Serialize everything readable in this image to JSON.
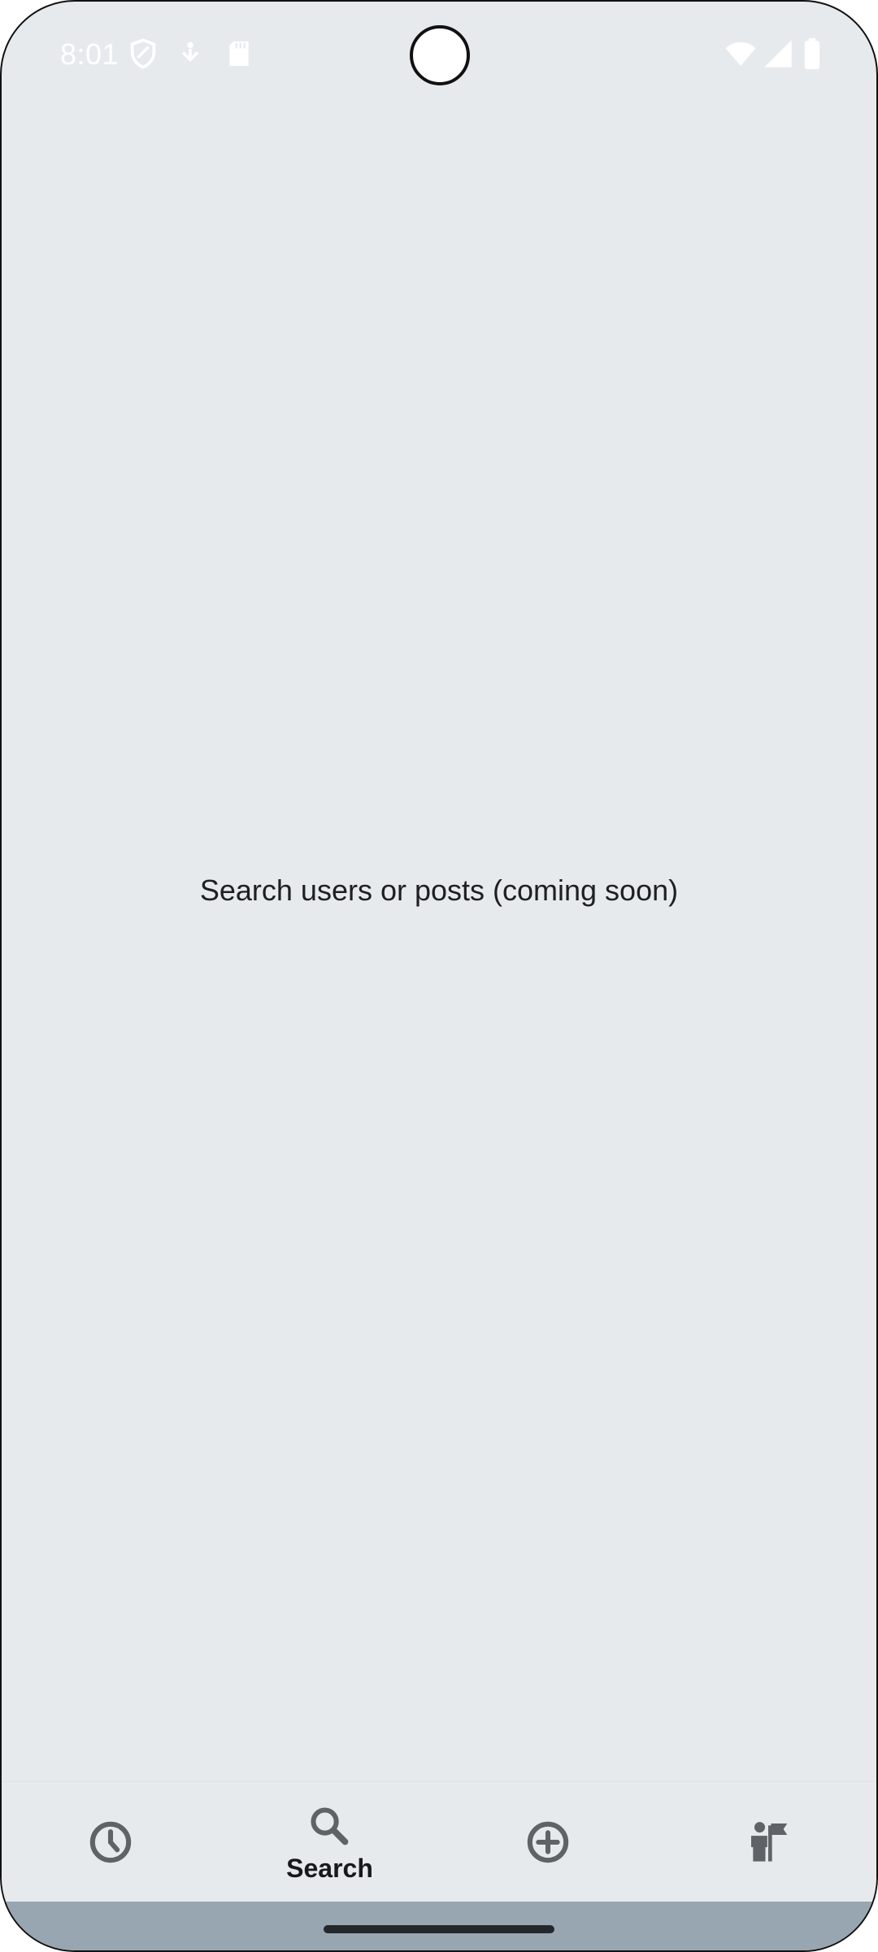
{
  "status_bar": {
    "time": "8:01",
    "left_icons": [
      "shield-icon",
      "download-icon",
      "sd-card-icon"
    ],
    "right_icons": [
      "wifi-icon",
      "signal-icon",
      "battery-icon"
    ],
    "icon_color": "#ffffff"
  },
  "main": {
    "message": "Search users or posts (coming soon)",
    "background_color": "#e7eaed"
  },
  "bottom_nav": {
    "items": [
      {
        "id": "recent",
        "icon": "clock-icon",
        "label": "",
        "selected": false
      },
      {
        "id": "search",
        "icon": "search-icon",
        "label": "Search",
        "selected": true
      },
      {
        "id": "create",
        "icon": "add-circle-icon",
        "label": "",
        "selected": false
      },
      {
        "id": "profile",
        "icon": "person-flag-icon",
        "label": "",
        "selected": false
      }
    ],
    "icon_color": "#5f6368",
    "selected_label_color": "#17191c"
  },
  "system_nav": {
    "bar_color": "#98a6b1",
    "handle_color": "#24282c"
  }
}
